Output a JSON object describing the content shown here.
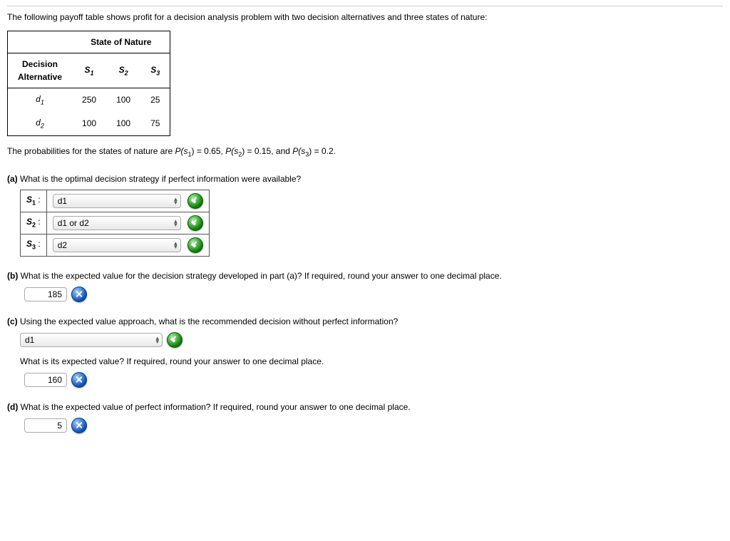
{
  "intro": "The following payoff table shows profit for a decision analysis problem with two decision alternatives and three states of nature:",
  "table": {
    "state_of_nature": "State of Nature",
    "decision_alt_line1": "Decision",
    "decision_alt_line2": "Alternative",
    "s1": "S",
    "s1_sub": "1",
    "s2": "S",
    "s2_sub": "2",
    "s3": "S",
    "s3_sub": "3",
    "d1": "d",
    "d1_sub": "1",
    "d2": "d",
    "d2_sub": "2",
    "r1": [
      "250",
      "100",
      "25"
    ],
    "r2": [
      "100",
      "100",
      "75"
    ]
  },
  "prob_prefix": "The probabilities for the states of nature are ",
  "prob_ps1": "P(s",
  "prob_ps1_sub": "1",
  "prob_ps1_end": ") = 0.65, ",
  "prob_ps2": "P(s",
  "prob_ps2_sub": "2",
  "prob_ps2_end": ") = 0.15, and ",
  "prob_ps3": "P(s",
  "prob_ps3_sub": "3",
  "prob_ps3_end": ") = 0.2.",
  "a": {
    "label": "(a)",
    "text": " What is the optimal decision strategy if perfect information were available?",
    "rows": [
      {
        "label": "S",
        "sub": "1",
        "sep": " :",
        "value": "d1"
      },
      {
        "label": "S",
        "sub": "2",
        "sep": " :",
        "value": "d1 or d2"
      },
      {
        "label": "S",
        "sub": "3",
        "sep": " :",
        "value": "d2"
      }
    ]
  },
  "b": {
    "label": "(b)",
    "text": " What is the expected value for the decision strategy developed in part (a)? If required, round your answer to one decimal place.",
    "value": "185"
  },
  "c": {
    "label": "(c)",
    "text": " Using the expected value approach, what is the recommended decision without perfect information?",
    "dropdown": "d1",
    "sub_q": "What is its expected value? If required, round your answer to one decimal place.",
    "value": "160"
  },
  "d": {
    "label": "(d)",
    "text": " What is the expected value of perfect information? If required, round your answer to one decimal place.",
    "value": "5"
  }
}
